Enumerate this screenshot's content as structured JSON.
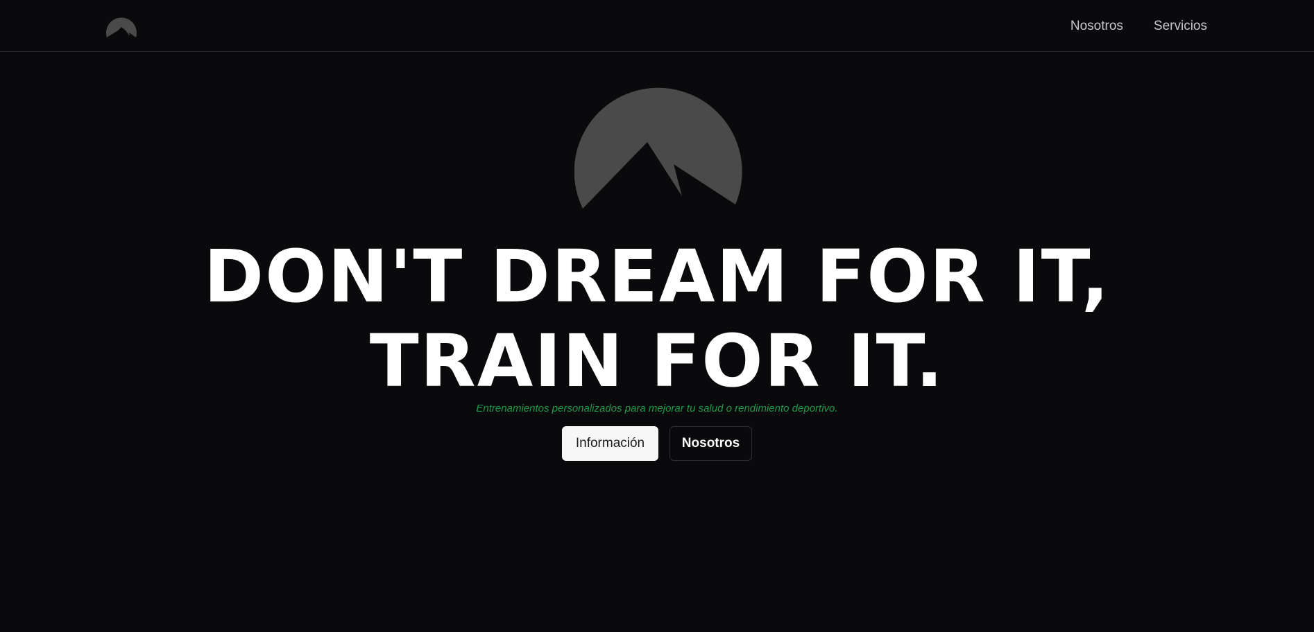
{
  "nav": {
    "logo_icon": "mountain-logo-icon",
    "links": [
      "Nosotros",
      "Servicios"
    ]
  },
  "hero": {
    "logo_icon": "mountain-logo-icon",
    "headline_line1": "DON'T DREAM FOR IT,",
    "headline_line2": "TRAIN FOR IT.",
    "subtitle": "Entrenamientos personalizados para mejorar tu salud o rendimiento deportivo.",
    "primary_button": "Información",
    "secondary_button": "Nosotros"
  },
  "colors": {
    "background": "#0a0a0c",
    "logo": "#4a4a4a",
    "subtitle": "#1f9a4a",
    "primary_button_bg": "#f7f7f7",
    "nav_text": "#c7c7cc"
  }
}
